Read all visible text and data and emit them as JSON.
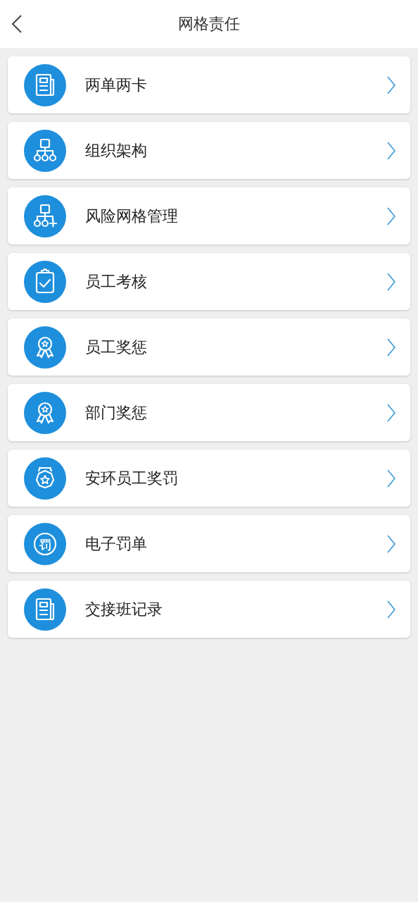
{
  "header": {
    "title": "网格责任"
  },
  "menu_items": [
    {
      "label": "两单两卡",
      "kind": "document"
    },
    {
      "label": "组织架构",
      "kind": "orgchart"
    },
    {
      "label": "风险网格管理",
      "kind": "orgplus"
    },
    {
      "label": "员工考核",
      "kind": "clipboard"
    },
    {
      "label": "员工奖惩",
      "kind": "medal"
    },
    {
      "label": "部门奖惩",
      "kind": "medal"
    },
    {
      "label": "安环员工奖罚",
      "kind": "badge"
    },
    {
      "label": "电子罚单",
      "kind": "stamp",
      "icon_text": "罚"
    },
    {
      "label": "交接班记录",
      "kind": "document"
    }
  ]
}
